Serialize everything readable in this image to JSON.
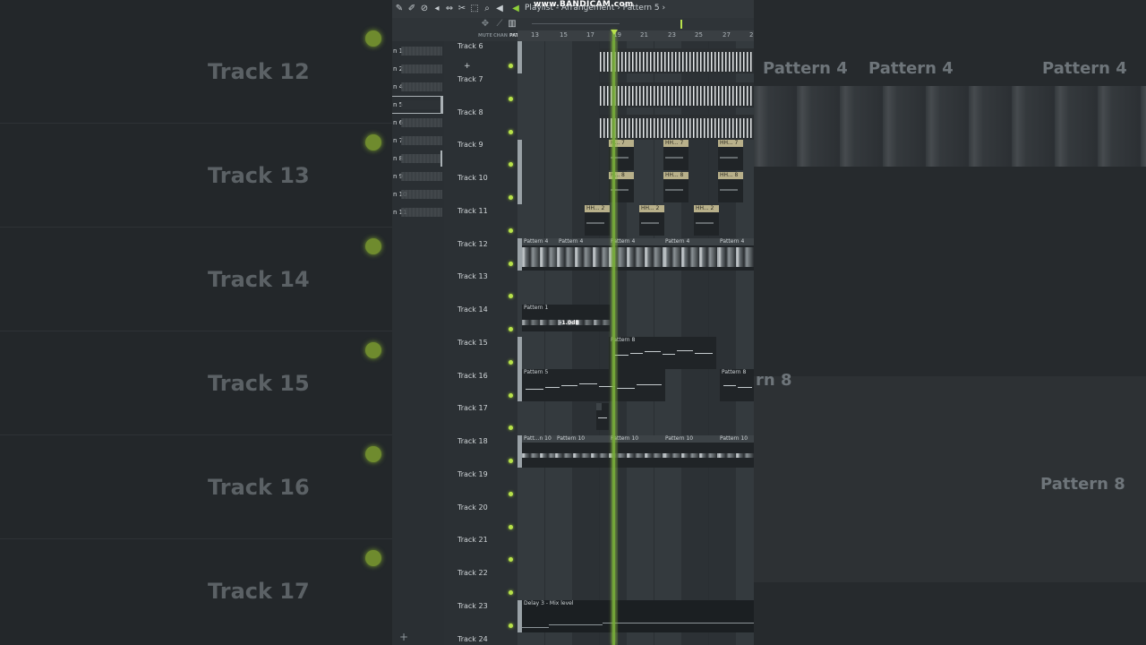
{
  "window": {
    "title": "Playlist - Arrangement › Pattern 5 ›",
    "watermark": "www.BANDICAM.com"
  },
  "toolbar_icons": [
    "pencil-icon",
    "paint-icon",
    "delete-icon",
    "mute-icon",
    "slip-icon",
    "slice-icon",
    "select-icon",
    "zoom-icon",
    "playback-icon"
  ],
  "header_labels": {
    "mute": "MUTE",
    "chan": "CHAN",
    "pat": "PAT",
    "add": "+"
  },
  "ruler": [
    "13",
    "15",
    "17",
    "19",
    "21",
    "23",
    "25",
    "27",
    "2"
  ],
  "picker": {
    "items": [
      "n 1",
      "n 2",
      "n 4",
      "n 5",
      "n 6",
      "n 7",
      "n 8",
      "n 9",
      "n 10",
      "n 11"
    ],
    "selected": "n 5",
    "add": "+"
  },
  "tracks": [
    "Track 6",
    "Track 7",
    "Track 8",
    "Track 9",
    "Track 10",
    "Track 11",
    "Track 12",
    "Track 13",
    "Track 14",
    "Track 15",
    "Track 16",
    "Track 17",
    "Track 18",
    "Track 19",
    "Track 20",
    "Track 21",
    "Track 22",
    "Track 23",
    "Track 24"
  ],
  "clips": {
    "hh7": "H... 7",
    "hh7b": "HH... 7",
    "hh8": "H... 8",
    "hh8b": "HH... 8",
    "hh2": "HH... 2",
    "pattern4": "Pattern 4",
    "pattern1": "Pattern 1",
    "db": "-1.0dB",
    "pattern8": "Pattern 8",
    "pattern5": "Pattern 5",
    "pattern10": "Pattern 10",
    "pattern10short": "Patt...n 10",
    "automation": "Delay 3 - Mix level"
  },
  "background": {
    "left_tracks": [
      "Track 12",
      "Track 13",
      "Track 14",
      "Track 15",
      "Track 16",
      "Track 17"
    ],
    "right_labels": [
      "Pattern 4",
      "Pattern 4",
      "Pattern 4",
      "rn 8",
      "Pattern 8"
    ]
  },
  "colors": {
    "playhead": "#7ab03a",
    "track_led": "#b8e24a",
    "clip_header_tan": "#b8b08a"
  }
}
